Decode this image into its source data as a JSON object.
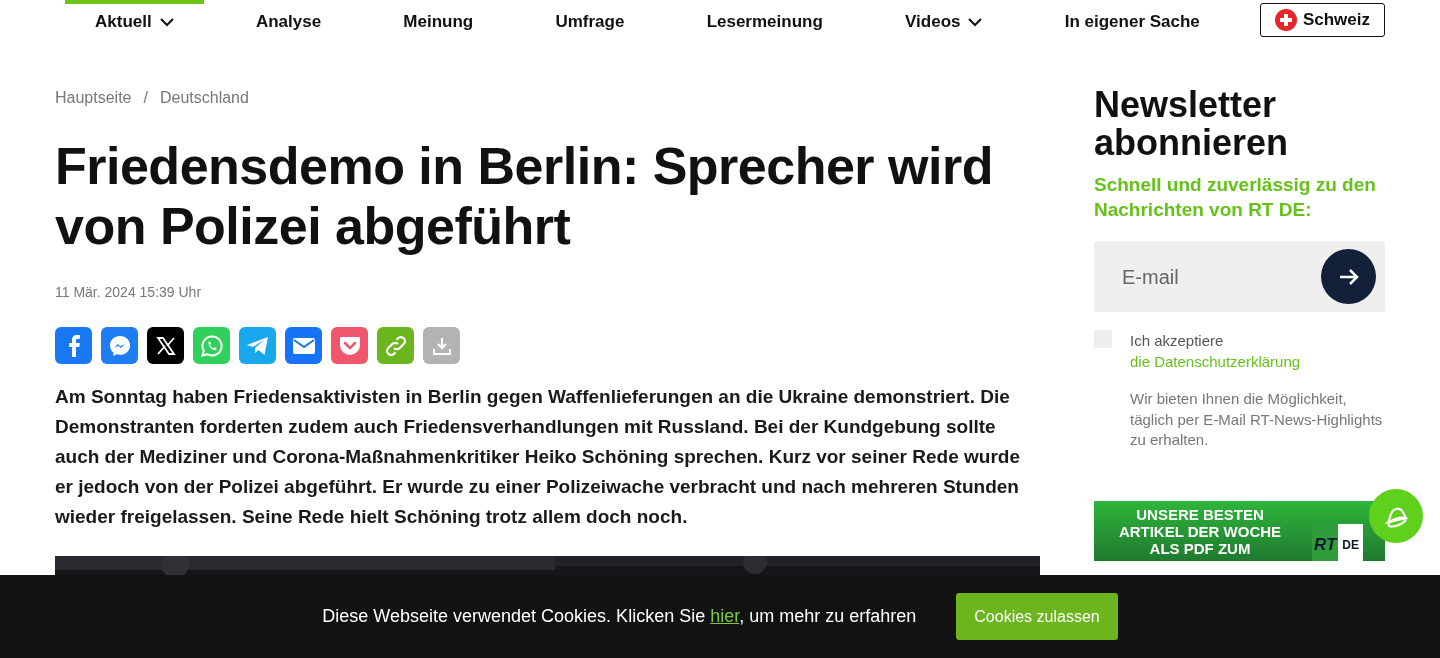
{
  "nav": {
    "items": [
      {
        "label": "Aktuell",
        "selected": true,
        "has_menu": true
      },
      {
        "label": "Analyse",
        "selected": false,
        "has_menu": false
      },
      {
        "label": "Meinung",
        "selected": false,
        "has_menu": false
      },
      {
        "label": "Umfrage",
        "selected": false,
        "has_menu": false
      },
      {
        "label": "Lesermeinung",
        "selected": false,
        "has_menu": false
      },
      {
        "label": "Videos",
        "selected": false,
        "has_menu": true
      },
      {
        "label": "In eigener Sache",
        "selected": false,
        "has_menu": false
      }
    ],
    "region_button": "Schweiz"
  },
  "breadcrumb": [
    "Hauptseite",
    "Deutschland"
  ],
  "breadcrumb_separator": "/",
  "article": {
    "title": "Friedensdemo in Berlin: Sprecher wird von Polizei abgeführt",
    "date": "11 Mär. 2024 15:39 Uhr",
    "share": [
      {
        "kind": "facebook",
        "color": "#1877f2"
      },
      {
        "kind": "messenger",
        "color": "#1c7ef0"
      },
      {
        "kind": "x",
        "color": "#000000"
      },
      {
        "kind": "whatsapp",
        "color": "#2fd15a"
      },
      {
        "kind": "telegram",
        "color": "#19a7ee"
      },
      {
        "kind": "email",
        "color": "#1673f5"
      },
      {
        "kind": "pocket",
        "color": "#f0566c"
      },
      {
        "kind": "link",
        "color": "#6bb51f"
      },
      {
        "kind": "download",
        "color": "#b3b3b3"
      }
    ],
    "lead": "Am Sonntag haben Friedensaktivisten in Berlin gegen Waffenlieferungen an die Ukraine demonstriert. Die Demonstranten forderten zudem auch Friedensverhandlungen mit Russland. Bei der Kundgebung sollte auch der Mediziner und Corona-Maßnahmenkritiker Heiko Schöning sprechen. Kurz vor seiner Rede wurde er jedoch von der Polizei abgeführt. Er wurde zu einer Polizeiwache verbracht und nach mehreren Stunden wieder freigelassen. Seine Rede hielt Schöning trotz allem doch noch."
  },
  "newsletter": {
    "title": "Newsletter abonnieren",
    "subtitle": "Schnell und zuverlässig zu den Nachrichten von RT DE:",
    "email": {
      "placeholder": "E-mail"
    },
    "consent": {
      "checked": false,
      "text": "Ich akzeptiere ",
      "link": "die Datenschutzerklärung"
    },
    "note": "Wir bieten Ihnen die Möglichkeit, täglich per E-Mail RT-News-Highlights zu erhalten."
  },
  "promo": {
    "text": "UNSERE BESTEN ARTIKEL DER WOCHE ALS PDF ZUM",
    "logo_left": "RT",
    "logo_right": "DE"
  },
  "cookie_bar": {
    "text": "Diese Webseite verwendet Cookies. Klicken Sie ",
    "link": "hier",
    "text_after": ", um mehr zu erfahren",
    "button": "Cookies zulassen"
  }
}
